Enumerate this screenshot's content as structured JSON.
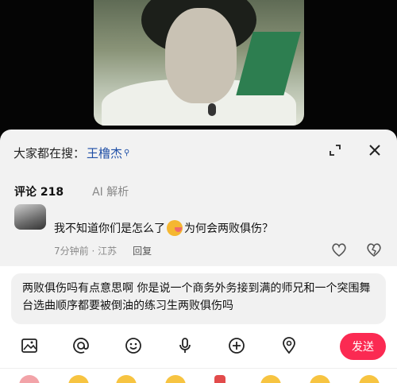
{
  "video": {
    "watermark": ""
  },
  "header": {
    "search_prefix": "大家都在搜：",
    "search_keyword": "王橹杰",
    "expand_icon": "expand-icon",
    "close_icon": "close-icon"
  },
  "tabs": [
    {
      "label": "评论 218",
      "active": true
    },
    {
      "label": "AI 解析",
      "active": false
    }
  ],
  "comment": {
    "text_before": "我不知道你们是怎么了",
    "text_after": "为何会两败俱伤？",
    "time_location": "7分钟前 · 江苏",
    "reply_label": "回复"
  },
  "input": {
    "value": "两败俱伤吗有点意思啊 你是说一个商务外务接到满的师兄和一个突围舞台选曲顺序都要被倒油的练习生两败俱伤吗"
  },
  "toolbar": {
    "icons": [
      "image-icon",
      "at-icon",
      "emoji-icon",
      "mic-icon",
      "add-icon",
      "location-icon"
    ],
    "send_label": "发送"
  },
  "colors": {
    "accent": "#fb2a52",
    "link": "#1f4fa6"
  }
}
